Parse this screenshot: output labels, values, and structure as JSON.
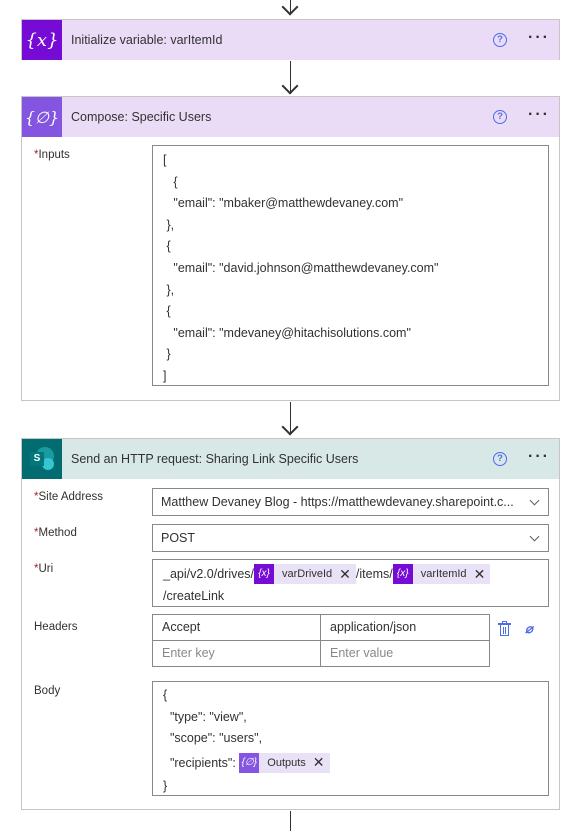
{
  "step_var": {
    "title": "Initialize variable: varItemId",
    "icon": "variable-icon"
  },
  "step_compose": {
    "title": "Compose: Specific Users",
    "icon": "compose-icon",
    "inputs_label": "Inputs",
    "inputs_lines": [
      "[",
      "   {",
      "   \"email\": \"mbaker@matthewdevaney.com\"",
      " },",
      " {",
      "   \"email\": \"david.johnson@matthewdevaney.com\"",
      " },",
      " {",
      "   \"email\": \"mdevaney@hitachisolutions.com\"",
      " }",
      "]"
    ]
  },
  "step_http": {
    "title": "Send an HTTP request: Sharing Link Specific Users",
    "icon": "sharepoint-icon",
    "site_label": "Site Address",
    "site_value": "Matthew Devaney Blog - https://matthewdevaney.sharepoint.c...",
    "method_label": "Method",
    "method_value": "POST",
    "uri_label": "Uri",
    "uri_part1": "_api/v2.0/drives/",
    "uri_token1": "varDriveId",
    "uri_part2": "/items/",
    "uri_token2": "varItemId",
    "uri_part3": "/createLink",
    "headers_label": "Headers",
    "header_key": "Accept",
    "header_value": "application/json",
    "header_key_placeholder": "Enter key",
    "header_value_placeholder": "Enter value",
    "body_label": "Body",
    "body_line1": "{",
    "body_line2": "  \"type\": \"view\",",
    "body_line3": "  \"scope\": \"users\",",
    "body_line4_prefix": "  \"recipients\": ",
    "body_token": "Outputs",
    "body_line5": "}"
  },
  "colors": {
    "variable_accent": "#770bd6",
    "compose_accent": "#8355e0",
    "sharepoint_accent": "#036c70",
    "required": "#a4262c",
    "help_blue": "#4f6bed"
  }
}
